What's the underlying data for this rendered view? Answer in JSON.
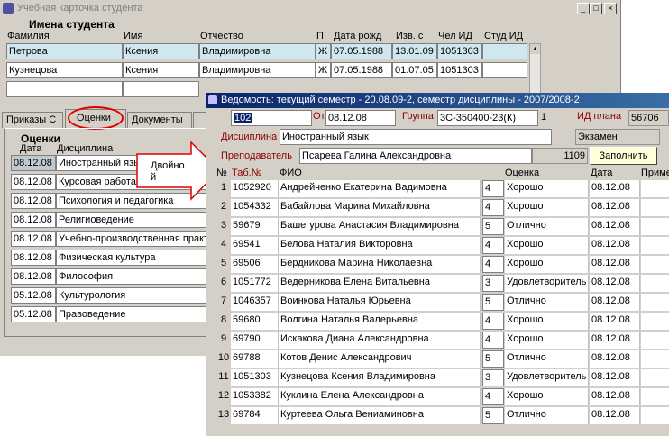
{
  "main_window": {
    "title": "Учебная карточка студента",
    "section_students": "Имена студента",
    "columns": [
      "Фамилия",
      "Имя",
      "Отчество",
      "П",
      "Дата рожд",
      "Изв. с",
      "Чел ИД",
      "Студ ИД"
    ],
    "students": [
      {
        "last": "Петрова",
        "first": "Ксения",
        "middle": "Владимировна",
        "sex": "Ж",
        "birth": "07.05.1988",
        "since": "13.01.09",
        "person_id": "1051303",
        "stud_id": ""
      },
      {
        "last": "Кузнецова",
        "first": "Ксения",
        "middle": "Владимировна",
        "sex": "Ж",
        "birth": "07.05.1988",
        "since": "01.07.05",
        "person_id": "1051303",
        "stud_id": ""
      }
    ],
    "tabs": [
      "Приказы С",
      "Оценки",
      "Документы"
    ],
    "grades_section": "Оценки",
    "grades_columns": [
      "Дата",
      "Дисциплина"
    ],
    "grades": [
      {
        "date": "08.12.08",
        "discipline": "Иностранный язык"
      },
      {
        "date": "08.12.08",
        "discipline": "Курсовая работа"
      },
      {
        "date": "08.12.08",
        "discipline": "Психология и педагогика"
      },
      {
        "date": "08.12.08",
        "discipline": "Религиоведение"
      },
      {
        "date": "08.12.08",
        "discipline": "Учебно-производственная практика"
      },
      {
        "date": "08.12.08",
        "discipline": "Физическая культура"
      },
      {
        "date": "08.12.08",
        "discipline": "Философия"
      },
      {
        "date": "05.12.08",
        "discipline": "Культурология"
      },
      {
        "date": "05.12.08",
        "discipline": "Правоведение"
      }
    ]
  },
  "callout": {
    "line1": "Двойно",
    "line2": "й"
  },
  "dialog": {
    "title": "Ведомость: текущий семестр - 20.08.09-2, семестр дисциплины - 2007/2008-2",
    "no_label": "№",
    "no_value": "102",
    "from_label": "От",
    "from_value": "08.12.08",
    "group_label": "Группа",
    "group_value": "3С-350400-23(К)",
    "group_extra": "1",
    "plan_label": "ИД плана",
    "plan_value": "56706",
    "discipline_label": "Дисциплина",
    "discipline_value": "Иностранный язык",
    "exam_type": "Экзамен",
    "teacher_label": "Преподаватель",
    "teacher_value": "Псарева Галина Александровна",
    "teacher_id": "1109",
    "fill_button": "Заполнить",
    "columns": [
      "№",
      "Таб.№",
      "ФИО",
      "Оценка",
      "Дата",
      "Приме"
    ],
    "rows": [
      {
        "n": "1",
        "tab": "1052920",
        "fio": "Андрейченко Екатерина Вадимовна",
        "score": "4",
        "grade": "Хорошо",
        "date": "08.12.08"
      },
      {
        "n": "2",
        "tab": "1054332",
        "fio": "Бабайлова Марина Михайловна",
        "score": "4",
        "grade": "Хорошо",
        "date": "08.12.08"
      },
      {
        "n": "3",
        "tab": "59679",
        "fio": "Башегурова Анастасия Владимировна",
        "score": "5",
        "grade": "Отлично",
        "date": "08.12.08"
      },
      {
        "n": "4",
        "tab": "69541",
        "fio": "Белова Наталия Викторовна",
        "score": "4",
        "grade": "Хорошо",
        "date": "08.12.08"
      },
      {
        "n": "5",
        "tab": "69506",
        "fio": "Бердникова Марина Николаевна",
        "score": "4",
        "grade": "Хорошо",
        "date": "08.12.08"
      },
      {
        "n": "6",
        "tab": "1051772",
        "fio": "Ведерникова Елена Витальевна",
        "score": "3",
        "grade": "Удовлетворитель",
        "date": "08.12.08"
      },
      {
        "n": "7",
        "tab": "1046357",
        "fio": "Воинкова Наталья Юрьевна",
        "score": "5",
        "grade": "Отлично",
        "date": "08.12.08"
      },
      {
        "n": "8",
        "tab": "59680",
        "fio": "Волгина Наталья Валерьевна",
        "score": "4",
        "grade": "Хорошо",
        "date": "08.12.08"
      },
      {
        "n": "9",
        "tab": "69790",
        "fio": "Искакова Диана Александровна",
        "score": "4",
        "grade": "Хорошо",
        "date": "08.12.08"
      },
      {
        "n": "10",
        "tab": "69788",
        "fio": "Котов Денис Александрович",
        "score": "5",
        "grade": "Отлично",
        "date": "08.12.08"
      },
      {
        "n": "11",
        "tab": "1051303",
        "fio": "Кузнецова Ксения Владимировна",
        "score": "3",
        "grade": "Удовлетворитель",
        "date": "08.12.08"
      },
      {
        "n": "12",
        "tab": "1053382",
        "fio": "Куклина Елена Александровна",
        "score": "4",
        "grade": "Хорошо",
        "date": "08.12.08"
      },
      {
        "n": "13",
        "tab": "69784",
        "fio": "Куртеева Ольга Вениаминовна",
        "score": "5",
        "grade": "Отлично",
        "date": "08.12.08"
      }
    ]
  }
}
